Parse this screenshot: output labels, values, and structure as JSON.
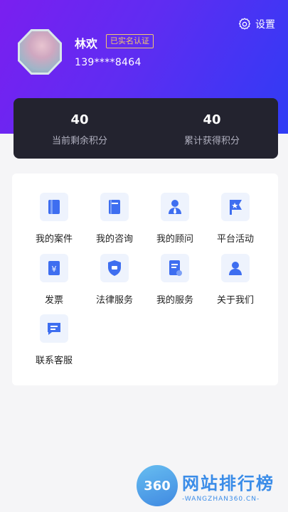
{
  "settings": {
    "label": "设置",
    "icon": "gear-icon"
  },
  "user": {
    "name": "林欢",
    "verified_label": "已实名认证",
    "phone": "139****8464",
    "badge_color": "#f2c86b"
  },
  "points": [
    {
      "value": "40",
      "label": "当前剩余积分"
    },
    {
      "value": "40",
      "label": "累计获得积分"
    }
  ],
  "services": [
    {
      "label": "我的案件",
      "icon": "case-book-icon"
    },
    {
      "label": "我的咨询",
      "icon": "consult-book-icon"
    },
    {
      "label": "我的顾问",
      "icon": "advisor-person-icon"
    },
    {
      "label": "平台活动",
      "icon": "activity-flag-icon"
    },
    {
      "label": "发票",
      "icon": "invoice-yen-icon"
    },
    {
      "label": "法律服务",
      "icon": "law-shield-icon"
    },
    {
      "label": "我的服务",
      "icon": "service-document-icon"
    },
    {
      "label": "关于我们",
      "icon": "about-person-icon"
    },
    {
      "label": "联系客服",
      "icon": "chat-bubble-icon"
    }
  ],
  "watermark": {
    "logo_text": "360",
    "title": "网站排行榜",
    "subtitle": "-WANGZHAN360.CN-"
  },
  "colors": {
    "header_start": "#7a1ff0",
    "header_end": "#2f3cf5",
    "icon_blue": "#3e6ef0",
    "card_dark": "#23232f"
  }
}
